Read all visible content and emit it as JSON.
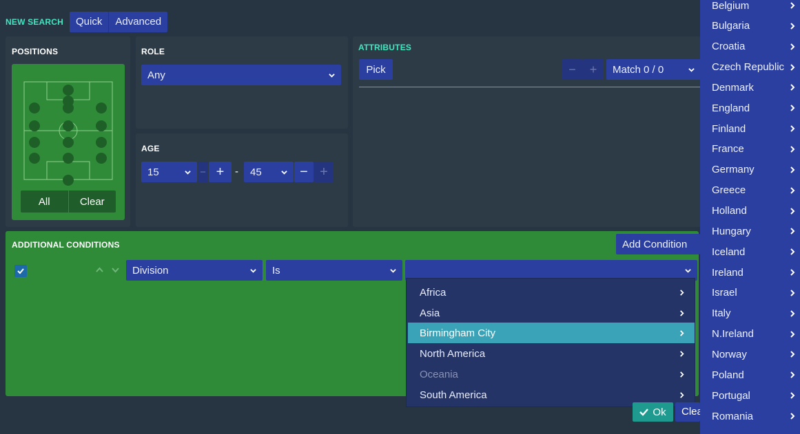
{
  "header": {
    "new_search": "NEW SEARCH",
    "tabs": [
      {
        "label": "Quick"
      },
      {
        "label": "Advanced"
      }
    ]
  },
  "positions": {
    "title": "POSITIONS",
    "all_label": "All",
    "clear_label": "Clear"
  },
  "role": {
    "title": "ROLE",
    "value": "Any"
  },
  "age": {
    "title": "AGE",
    "min": "15",
    "max": "45",
    "separator": "-",
    "minus": "−",
    "plus": "+"
  },
  "attributes": {
    "title": "ATTRIBUTES",
    "pick_label": "Pick",
    "match_label": "Match 0 / 0",
    "minus": "−",
    "plus": "+"
  },
  "conditions": {
    "title": "ADDITIONAL CONDITIONS",
    "add_label": "Add Condition",
    "row": {
      "field": "Division",
      "operator": "Is",
      "value": ""
    }
  },
  "dropdown": {
    "items": [
      {
        "label": "Africa",
        "state": "normal"
      },
      {
        "label": "Asia",
        "state": "normal"
      },
      {
        "label": "Birmingham City",
        "state": "highlighted"
      },
      {
        "label": "North America",
        "state": "normal"
      },
      {
        "label": "Oceania",
        "state": "disabled"
      },
      {
        "label": "South America",
        "state": "normal"
      }
    ]
  },
  "countries": [
    {
      "label": "Belgium"
    },
    {
      "label": "Bulgaria"
    },
    {
      "label": "Croatia"
    },
    {
      "label": "Czech Republic"
    },
    {
      "label": "Denmark"
    },
    {
      "label": "England"
    },
    {
      "label": "Finland"
    },
    {
      "label": "France"
    },
    {
      "label": "Germany"
    },
    {
      "label": "Greece"
    },
    {
      "label": "Holland"
    },
    {
      "label": "Hungary"
    },
    {
      "label": "Iceland"
    },
    {
      "label": "Ireland"
    },
    {
      "label": "Israel"
    },
    {
      "label": "Italy"
    },
    {
      "label": "N.Ireland"
    },
    {
      "label": "Norway"
    },
    {
      "label": "Poland"
    },
    {
      "label": "Portugal"
    },
    {
      "label": "Romania"
    }
  ],
  "footer": {
    "ok_label": "Ok",
    "clear_label": "Clea"
  },
  "colors": {
    "background": "#263541",
    "panel": "#2d3b47",
    "accent_blue": "#2a3fa0",
    "pitch_green": "#2f8b38",
    "highlight_teal": "#3aa3b8",
    "mint_header": "#3fe8c0"
  }
}
